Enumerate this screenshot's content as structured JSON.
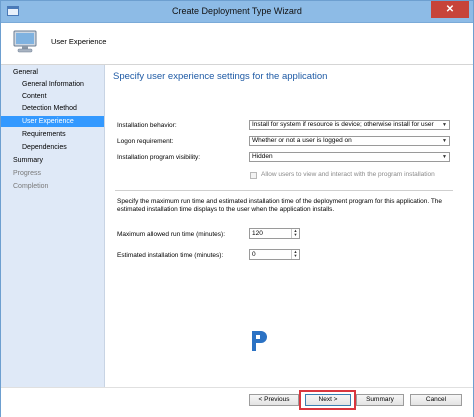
{
  "window": {
    "title": "Create Deployment Type Wizard",
    "close_glyph": "✕"
  },
  "header": {
    "title": "User Experience"
  },
  "nav": {
    "items": [
      {
        "label": "General"
      },
      {
        "label": "General Information"
      },
      {
        "label": "Content"
      },
      {
        "label": "Detection Method"
      },
      {
        "label": "User Experience"
      },
      {
        "label": "Requirements"
      },
      {
        "label": "Dependencies"
      },
      {
        "label": "Summary"
      },
      {
        "label": "Progress"
      },
      {
        "label": "Completion"
      }
    ],
    "active_index": 4
  },
  "content": {
    "title": "Specify user experience settings for the application",
    "fields": {
      "installation_behavior": {
        "label": "Installation behavior:",
        "value": "Install for system if resource is device; otherwise install for user"
      },
      "logon_requirement": {
        "label": "Logon requirement:",
        "value": "Whether or not a user is logged on"
      },
      "program_visibility": {
        "label": "Installation program visibility:",
        "value": "Hidden"
      }
    },
    "checkbox": {
      "label": "Allow users to view and interact with the program installation",
      "checked": false,
      "enabled": false
    },
    "description": "Specify the maximum run time and estimated installation time of the deployment program for this application. The estimated installation time displays to the user when the application installs.",
    "max_run_time": {
      "label": "Maximum allowed run time (minutes):",
      "value": "120"
    },
    "est_install_time": {
      "label": "Estimated installation time (minutes):",
      "value": "0"
    }
  },
  "footer": {
    "prev_label": "< Previous",
    "next_label": "Next >",
    "summary_label": "Summary",
    "cancel_label": "Cancel"
  },
  "colors": {
    "title_bar": "#8dbbe6",
    "nav_bg": "#dfe9f7",
    "nav_active": "#3399ff",
    "heading_blue": "#1e5aa5",
    "highlight_red": "#d9363e",
    "close_red": "#c7443a"
  },
  "icons": {
    "app": "wizard-window-icon",
    "header": "computer-monitor-icon",
    "logo": "p-logo-watermark"
  }
}
